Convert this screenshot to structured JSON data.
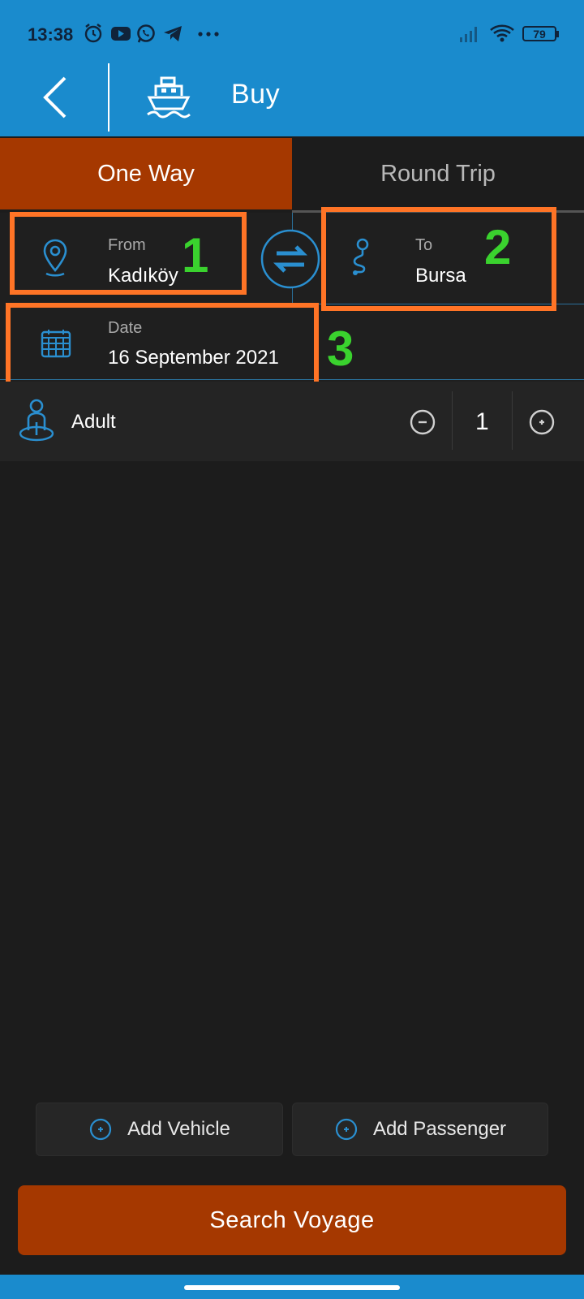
{
  "status_bar": {
    "time": "13:38",
    "battery": "79",
    "icons": [
      "alarm-icon",
      "youtube-icon",
      "whatsapp-icon",
      "telegram-icon",
      "more-dots-icon",
      "signal-icon",
      "wifi-icon",
      "battery-icon"
    ]
  },
  "app_bar": {
    "title": "Buy",
    "icons": [
      "back-arrow-icon",
      "ship-icon"
    ]
  },
  "tabs": [
    {
      "label": "One Way",
      "active": true
    },
    {
      "label": "Round Trip",
      "active": false
    }
  ],
  "form": {
    "from": {
      "label": "From",
      "value": "Kadıköy",
      "icon": "location-pin-icon"
    },
    "to": {
      "label": "To",
      "value": "Bursa",
      "icon": "route-icon"
    },
    "swap_icon": "swap-arrows-icon",
    "date": {
      "label": "Date",
      "value": "16 September 2021",
      "icon": "calendar-icon"
    }
  },
  "passengers": {
    "type_label": "Adult",
    "count": "1",
    "icons": [
      "person-icon",
      "minus-circle-icon",
      "plus-circle-icon"
    ]
  },
  "annotations": [
    "1",
    "2",
    "3"
  ],
  "buttons": {
    "add_vehicle": "Add Vehicle",
    "add_passenger": "Add Passenger",
    "search": "Search Voyage"
  },
  "colors": {
    "accent_blue": "#1a8bcd",
    "brand_orange": "#a53800",
    "annotation_orange": "#ff7426",
    "annotation_green": "#3ad22e",
    "background": "#1c1c1c"
  }
}
